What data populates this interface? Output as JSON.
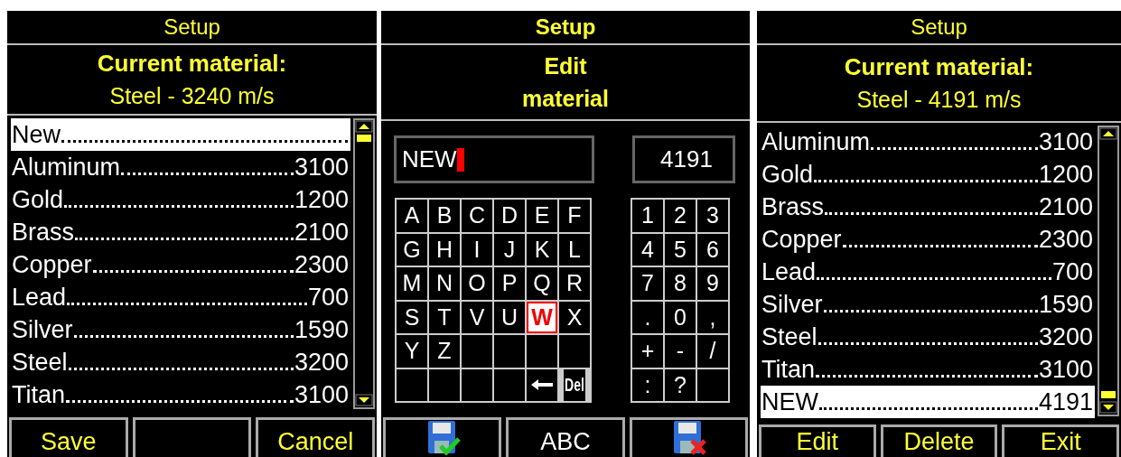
{
  "panels": [
    {
      "kind": "list",
      "title": "Setup",
      "header": [
        "Current material:",
        "Steel - 3240 m/s"
      ],
      "items": [
        {
          "name": "New",
          "selected": true
        },
        {
          "name": "Aluminum",
          "value": "3100",
          "selected": false
        },
        {
          "name": "Gold",
          "value": "1200",
          "selected": false
        },
        {
          "name": "Brass",
          "value": "2100",
          "selected": false
        },
        {
          "name": "Copper",
          "value": "2300",
          "selected": false
        },
        {
          "name": "Lead",
          "value": "700",
          "selected": false
        },
        {
          "name": "Silver",
          "value": "1590",
          "selected": false
        },
        {
          "name": "Steel",
          "value": "3200",
          "selected": false
        },
        {
          "name": "Titan",
          "value": "3100",
          "selected": false
        }
      ],
      "buttons": [
        {
          "kind": "text",
          "label": "Save"
        },
        {
          "kind": "blank"
        },
        {
          "kind": "text",
          "label": "Cancel"
        }
      ]
    },
    {
      "kind": "editor",
      "title": "Setup",
      "header": [
        "Edit",
        "material"
      ],
      "name_field": {
        "value": "NEW",
        "cursor": true
      },
      "number_field": {
        "value": "4191"
      },
      "letter_keys": [
        {
          "kind": "char",
          "label": "A",
          "selected": false
        },
        {
          "kind": "char",
          "label": "B",
          "selected": false
        },
        {
          "kind": "char",
          "label": "C",
          "selected": false
        },
        {
          "kind": "char",
          "label": "D",
          "selected": false
        },
        {
          "kind": "char",
          "label": "E",
          "selected": false
        },
        {
          "kind": "char",
          "label": "F",
          "selected": false
        },
        {
          "kind": "char",
          "label": "G",
          "selected": false
        },
        {
          "kind": "char",
          "label": "H",
          "selected": false
        },
        {
          "kind": "char",
          "label": "I",
          "selected": false
        },
        {
          "kind": "char",
          "label": "J",
          "selected": false
        },
        {
          "kind": "char",
          "label": "K",
          "selected": false
        },
        {
          "kind": "char",
          "label": "L",
          "selected": false
        },
        {
          "kind": "char",
          "label": "M",
          "selected": false
        },
        {
          "kind": "char",
          "label": "N",
          "selected": false
        },
        {
          "kind": "char",
          "label": "O",
          "selected": false
        },
        {
          "kind": "char",
          "label": "P",
          "selected": false
        },
        {
          "kind": "char",
          "label": "Q",
          "selected": false
        },
        {
          "kind": "char",
          "label": "R",
          "selected": false
        },
        {
          "kind": "char",
          "label": "S",
          "selected": false
        },
        {
          "kind": "char",
          "label": "T",
          "selected": false
        },
        {
          "kind": "char",
          "label": "V",
          "selected": false
        },
        {
          "kind": "char",
          "label": "U",
          "selected": false
        },
        {
          "kind": "char",
          "label": "W",
          "selected": true
        },
        {
          "kind": "char",
          "label": "X",
          "selected": false
        },
        {
          "kind": "char",
          "label": "Y",
          "selected": false
        },
        {
          "kind": "char",
          "label": "Z",
          "selected": false
        },
        {
          "kind": "blank"
        },
        {
          "kind": "blank"
        },
        {
          "kind": "blank"
        },
        {
          "kind": "blank"
        },
        {
          "kind": "blank"
        },
        {
          "kind": "blank"
        },
        {
          "kind": "blank"
        },
        {
          "kind": "blank"
        },
        {
          "kind": "backspace",
          "selected": false
        },
        {
          "kind": "del",
          "label": "Del",
          "selected": false
        }
      ],
      "number_keys": [
        {
          "kind": "char",
          "label": "1"
        },
        {
          "kind": "char",
          "label": "2"
        },
        {
          "kind": "char",
          "label": "3"
        },
        {
          "kind": "char",
          "label": "4"
        },
        {
          "kind": "char",
          "label": "5"
        },
        {
          "kind": "char",
          "label": "6"
        },
        {
          "kind": "char",
          "label": "7"
        },
        {
          "kind": "char",
          "label": "8"
        },
        {
          "kind": "char",
          "label": "9"
        },
        {
          "kind": "char",
          "label": "."
        },
        {
          "kind": "char",
          "label": "0"
        },
        {
          "kind": "char",
          "label": ","
        },
        {
          "kind": "char",
          "label": "+"
        },
        {
          "kind": "char",
          "label": "-"
        },
        {
          "kind": "char",
          "label": "/"
        },
        {
          "kind": "char",
          "label": ":"
        },
        {
          "kind": "char",
          "label": "?"
        },
        {
          "kind": "blank"
        }
      ],
      "buttons": [
        {
          "kind": "save-icon"
        },
        {
          "kind": "text",
          "label": "ABC"
        },
        {
          "kind": "cancel-icon"
        }
      ]
    },
    {
      "kind": "list",
      "title": "Setup",
      "header": [
        "Current material:",
        "Steel - 4191 m/s"
      ],
      "items": [
        {
          "name": "Aluminum",
          "value": "3100",
          "selected": false
        },
        {
          "name": "Gold",
          "value": "1200",
          "selected": false
        },
        {
          "name": "Brass",
          "value": "2100",
          "selected": false
        },
        {
          "name": "Copper",
          "value": "2300",
          "selected": false
        },
        {
          "name": "Lead",
          "value": "700",
          "selected": false
        },
        {
          "name": "Silver",
          "value": "1590",
          "selected": false
        },
        {
          "name": "Steel",
          "value": "3200",
          "selected": false
        },
        {
          "name": "Titan",
          "value": "3100",
          "selected": false
        },
        {
          "name": "NEW ",
          "value": "4191",
          "selected": true
        }
      ],
      "buttons": [
        {
          "kind": "text",
          "label": "Edit"
        },
        {
          "kind": "text",
          "label": "Delete"
        },
        {
          "kind": "text",
          "label": "Exit"
        }
      ]
    }
  ]
}
